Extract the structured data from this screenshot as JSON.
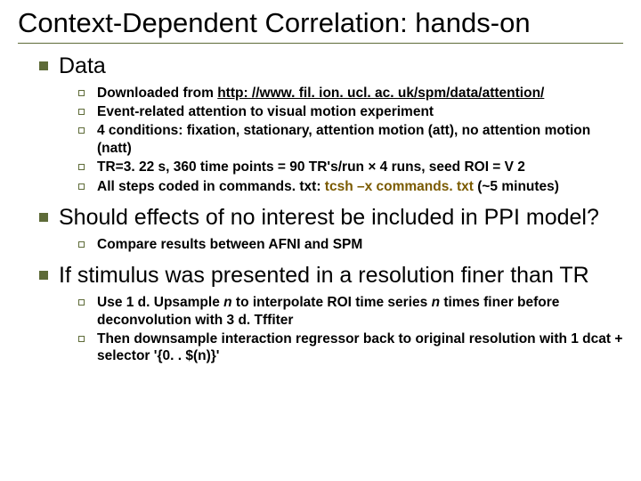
{
  "title": "Context-Dependent Correlation: hands-on",
  "sections": [
    {
      "heading": "Data",
      "items": [
        {
          "pre": "Downloaded from ",
          "link": "http: //www. fil. ion. ucl. ac. uk/spm/data/attention/"
        },
        {
          "text": "Event-related attention to visual motion experiment"
        },
        {
          "text": "4 conditions: fixation, stationary, attention motion (att), no attention motion (natt)"
        },
        {
          "text": "TR=3. 22 s, 360 time points = 90 TR's/run × 4 runs, seed ROI = V 2"
        },
        {
          "pre": "All steps coded in commands. txt: ",
          "cmd": "tcsh –x commands. txt",
          "post": " (~5 minutes)"
        }
      ]
    },
    {
      "heading": "Should effects of no interest be included in PPI model?",
      "items": [
        {
          "text": "Compare results between AFNI and SPM"
        }
      ]
    },
    {
      "heading": "If stimulus was presented in a resolution finer than TR",
      "items": [
        {
          "a": "Use 1 d. Upsample ",
          "b": "n",
          "c": " to interpolate ROI time series ",
          "d": "n",
          "e": " times finer before deconvolution with 3 d. Tffiter"
        },
        {
          "text": "Then downsample interaction regressor back to original resolution with 1 dcat + selector '{0. . $(n)}'"
        }
      ]
    }
  ]
}
